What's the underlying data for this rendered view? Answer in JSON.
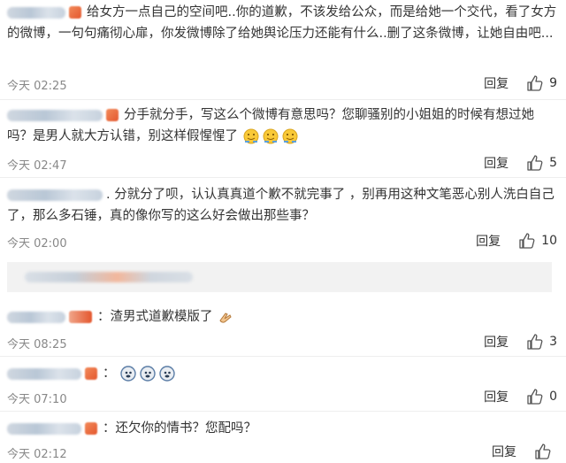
{
  "comments": [
    {
      "text": "给女方一点自己的空间吧..你的道歉，不该发给公众，而是给她一个交代，看了女方的微博，一句句痛彻心扉，你发微博除了给她舆论压力还能有什么..删了这条微博，让她自由吧...",
      "time": "今天 02:25",
      "reply": "回复",
      "likes": "9"
    },
    {
      "text": "分手就分手，写这么个微博有意思吗？您聊骚别的小姐姐的时候有想过她吗？是男人就大方认错，别这样假惺惺了",
      "time": "今天 02:47",
      "reply": "回复",
      "likes": "5"
    },
    {
      "text": ". 分就分了呗，认认真真道个歉不就完事了 ，别再用这种文笔恶心别人洗白自己了，那么多石锤，真的像你写的这么好会做出那些事？",
      "time": "今天 02:00",
      "reply": "回复",
      "likes": "10"
    },
    {
      "text": "：渣男式道歉模版了",
      "time": "今天 08:25",
      "reply": "回复",
      "likes": "3"
    },
    {
      "text": "：",
      "time": "今天 07:10",
      "reply": "回复",
      "likes": "0"
    },
    {
      "text": "：还欠你的情书？您配吗？",
      "time": "今天 02:12",
      "reply": "回复",
      "likes": ""
    }
  ],
  "icons": {
    "like": "thumbs-up-icon",
    "emoji_sweat": "sweat-smile-emoji-icon",
    "emoji_clap": "clapping-hands-emoji-icon",
    "emoji_doge": "doge-emoji-icon"
  },
  "colors": {
    "text": "#333333",
    "meta": "#888888",
    "divider": "#eeeeee"
  }
}
